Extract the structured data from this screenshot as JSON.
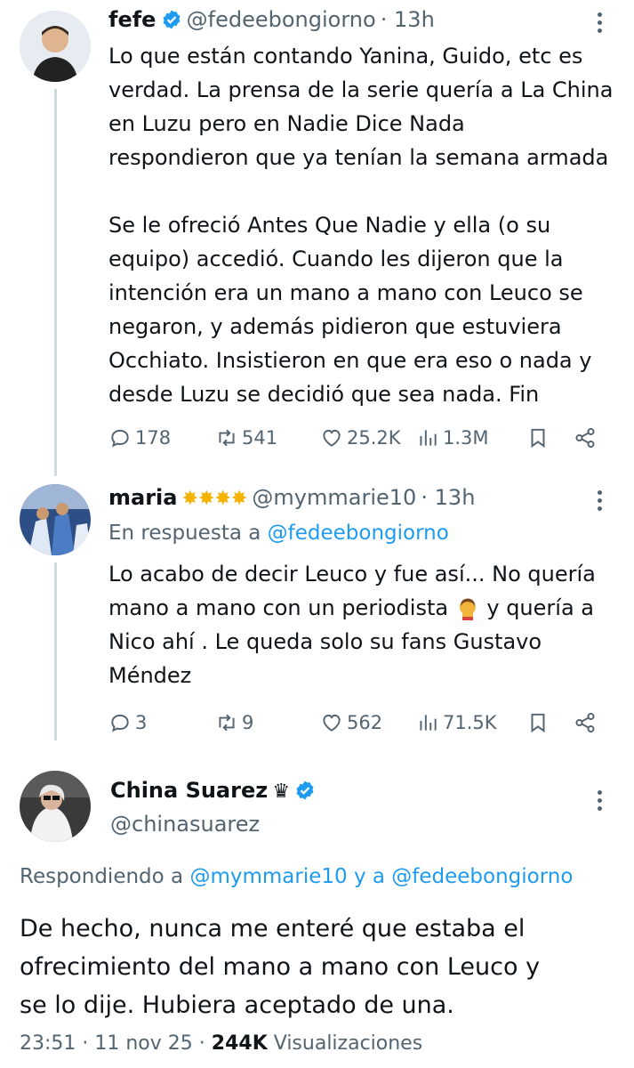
{
  "tweet1": {
    "name": "fefe",
    "handle": "@fedeebongiorno",
    "time": "· 13h",
    "paragraphs": [
      [
        "Lo que están contando Yanina, Guido, etc es",
        "verdad. La prensa de la serie quería a La China",
        "en Luzu pero en Nadie Dice Nada",
        "respondieron que ya tenían la semana armada"
      ],
      [
        "Se le ofreció Antes Que Nadie y ella (o su",
        "equipo) accedió. Cuando les dijeron que la",
        "intención era un mano a mano con Leuco se",
        "negaron, y además pidieron que estuviera",
        "Occhiato. Insistieron en que era eso o nada y",
        "desde Luzu se decidió que sea nada. Fin"
      ]
    ],
    "replies": "178",
    "reposts": "541",
    "likes": "25.2K",
    "views": "1.3M"
  },
  "tweet2": {
    "name": "maria",
    "handle": "@mymmarie10",
    "time": "· 13h",
    "reply_prefix": "En respuesta a",
    "reply_handle": "@fedeebongiorno",
    "lines": [
      "Lo acabo de decir Leuco y fue así... No quería",
      "mano a mano con un periodista",
      "y quería a",
      "Nico ahí . Le queda solo su fans  Gustavo",
      "Méndez"
    ],
    "replies": "3",
    "reposts": "9",
    "likes": "562",
    "views": "71.5K"
  },
  "tweet3": {
    "name": "China Suarez",
    "crown": "♛",
    "handle": "@chinasuarez",
    "reply_prefix": "Respondiendo a",
    "reply_handle1": "@mymmarie10",
    "reply_joiner": "y a",
    "reply_handle2": "@fedeebongiorno",
    "lines": [
      "De hecho, nunca me enteré que estaba el",
      "ofrecimiento del mano a mano con Leuco y",
      "se lo dije. Hubiera aceptado de una."
    ],
    "timestamp": "23:51 · 11 nov 25 ·",
    "views_count": "244K",
    "views_label": "Visualizaciones"
  },
  "colors": {
    "accent": "#1d9bf0",
    "text": "#0f1419",
    "muted": "#536471",
    "thread": "#cfd9de"
  },
  "icons": [
    "reply-icon",
    "repost-icon",
    "like-icon",
    "views-icon",
    "bookmark-icon",
    "share-icon",
    "verified-badge-icon",
    "more-options-icon",
    "star-icon",
    "crown-icon",
    "facepalm-emoji"
  ]
}
